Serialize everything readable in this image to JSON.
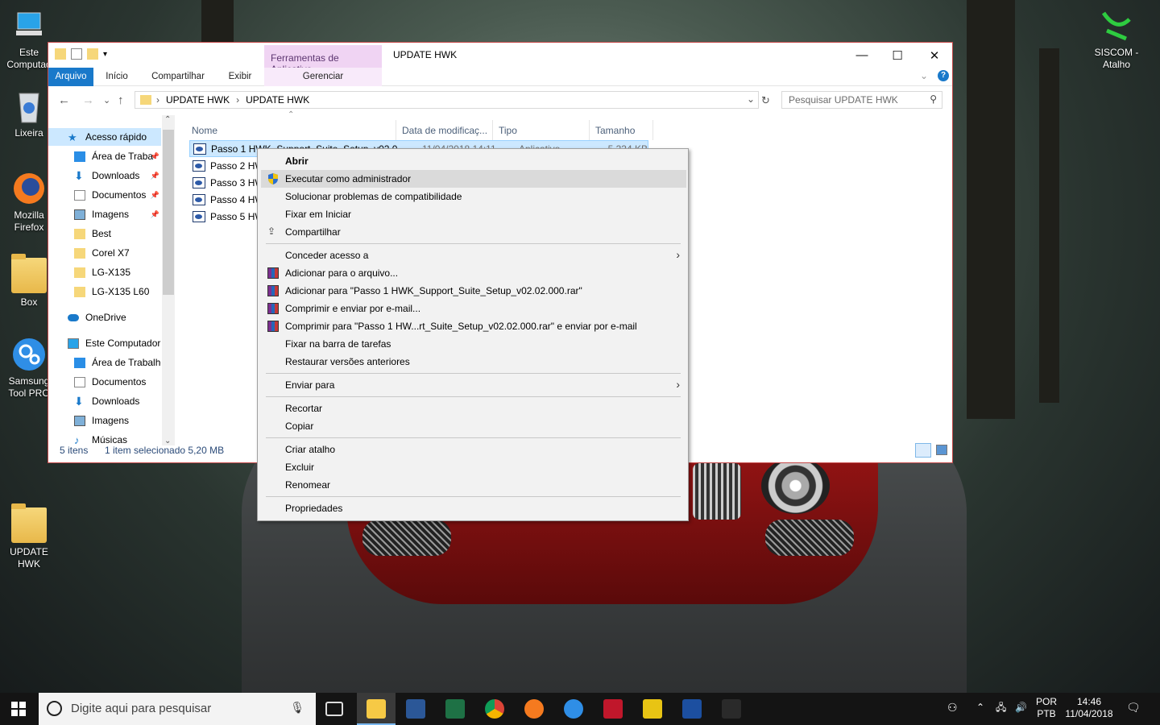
{
  "desktop": {
    "icons": [
      {
        "label": "Este Computad",
        "glyph": "computer-icon"
      },
      {
        "label": "Lixeira",
        "glyph": "recycle-bin-icon"
      },
      {
        "label": "Mozilla Firefox",
        "glyph": "firefox-icon"
      },
      {
        "label": "Box",
        "glyph": "folder-icon"
      },
      {
        "label": "Samsung Tool PRO",
        "glyph": "gears-icon"
      },
      {
        "label": "UPDATE HWK",
        "glyph": "folder-icon"
      },
      {
        "label": "SISCOM - Atalho",
        "glyph": "siscom-icon"
      }
    ]
  },
  "window": {
    "title": "UPDATE HWK",
    "contextual_tab_group": "Ferramentas de Aplicativo",
    "ribbon_tabs": [
      "Arquivo",
      "Início",
      "Compartilhar",
      "Exibir",
      "Gerenciar"
    ],
    "breadcrumb": [
      "UPDATE HWK",
      "UPDATE HWK"
    ],
    "search_placeholder": "Pesquisar UPDATE HWK",
    "nav": [
      {
        "label": "Acesso rápido",
        "icon": "star-icon"
      },
      {
        "label": "Área de Traba",
        "icon": "desktop-icon",
        "pinned": true
      },
      {
        "label": "Downloads",
        "icon": "download-icon",
        "pinned": true
      },
      {
        "label": "Documentos",
        "icon": "documents-icon",
        "pinned": true
      },
      {
        "label": "Imagens",
        "icon": "pictures-icon",
        "pinned": true
      },
      {
        "label": "Best",
        "icon": "folder-icon"
      },
      {
        "label": "Corel X7",
        "icon": "folder-icon"
      },
      {
        "label": "LG-X135",
        "icon": "folder-icon"
      },
      {
        "label": "LG-X135 L60",
        "icon": "folder-icon"
      },
      {
        "label": "OneDrive",
        "icon": "cloud-icon"
      },
      {
        "label": "Este Computador",
        "icon": "computer-icon"
      },
      {
        "label": "Área de Trabalho",
        "icon": "desktop-icon"
      },
      {
        "label": "Documentos",
        "icon": "documents-icon"
      },
      {
        "label": "Downloads",
        "icon": "download-icon"
      },
      {
        "label": "Imagens",
        "icon": "pictures-icon"
      },
      {
        "label": "Músicas",
        "icon": "music-icon"
      }
    ],
    "columns": [
      "Nome",
      "Data de modificaç...",
      "Tipo",
      "Tamanho"
    ],
    "files": [
      {
        "name": "Passo 1  HWK_Support_Suite_Setup_v02.0",
        "date": "11/04/2018 14:11",
        "type": "Aplicativo",
        "size": "5.334 KB",
        "selected": true
      },
      {
        "name": "Passo 2  HW",
        "date": "",
        "type": "",
        "size": ""
      },
      {
        "name": "Passo 3  HW",
        "date": "",
        "type": "",
        "size": ""
      },
      {
        "name": "Passo 4  HW",
        "date": "",
        "type": "",
        "size": ""
      },
      {
        "name": "Passo 5  HW",
        "date": "",
        "type": "",
        "size": ""
      }
    ],
    "status": {
      "count": "5 itens",
      "selection": "1 item selecionado  5,20 MB"
    }
  },
  "context_menu": {
    "groups": [
      [
        {
          "label": "Abrir",
          "bold": true
        },
        {
          "label": "Executar como administrador",
          "icon": "uac-shield-icon",
          "highlighted": true
        },
        {
          "label": "Solucionar problemas de compatibilidade"
        },
        {
          "label": "Fixar em Iniciar"
        },
        {
          "label": "Compartilhar",
          "icon": "share-icon"
        }
      ],
      [
        {
          "label": "Conceder acesso a",
          "submenu": true
        },
        {
          "label": "Adicionar para o arquivo...",
          "icon": "winrar-icon"
        },
        {
          "label": "Adicionar para \"Passo 1  HWK_Support_Suite_Setup_v02.02.000.rar\"",
          "icon": "winrar-icon"
        },
        {
          "label": "Comprimir e enviar por e-mail...",
          "icon": "winrar-icon"
        },
        {
          "label": "Comprimir para \"Passo 1  HW...rt_Suite_Setup_v02.02.000.rar\" e enviar por e-mail",
          "icon": "winrar-icon"
        },
        {
          "label": "Fixar na barra de tarefas"
        },
        {
          "label": "Restaurar versões anteriores"
        }
      ],
      [
        {
          "label": "Enviar para",
          "submenu": true
        }
      ],
      [
        {
          "label": "Recortar"
        },
        {
          "label": "Copiar"
        }
      ],
      [
        {
          "label": "Criar atalho"
        },
        {
          "label": "Excluir"
        },
        {
          "label": "Renomear"
        }
      ],
      [
        {
          "label": "Propriedades"
        }
      ]
    ]
  },
  "taskbar": {
    "search_placeholder": "Digite aqui para pesquisar",
    "apps": [
      "task-view-icon",
      "file-explorer-icon",
      "word-icon",
      "excel-icon",
      "chrome-icon",
      "firefox-icon",
      "samsung-tool-icon",
      "app-red-icon",
      "app-yellow-icon",
      "app-blue-icon",
      "app-dark-icon"
    ],
    "lang": [
      "POR",
      "PTB"
    ],
    "time": "14:46",
    "date": "11/04/2018"
  }
}
